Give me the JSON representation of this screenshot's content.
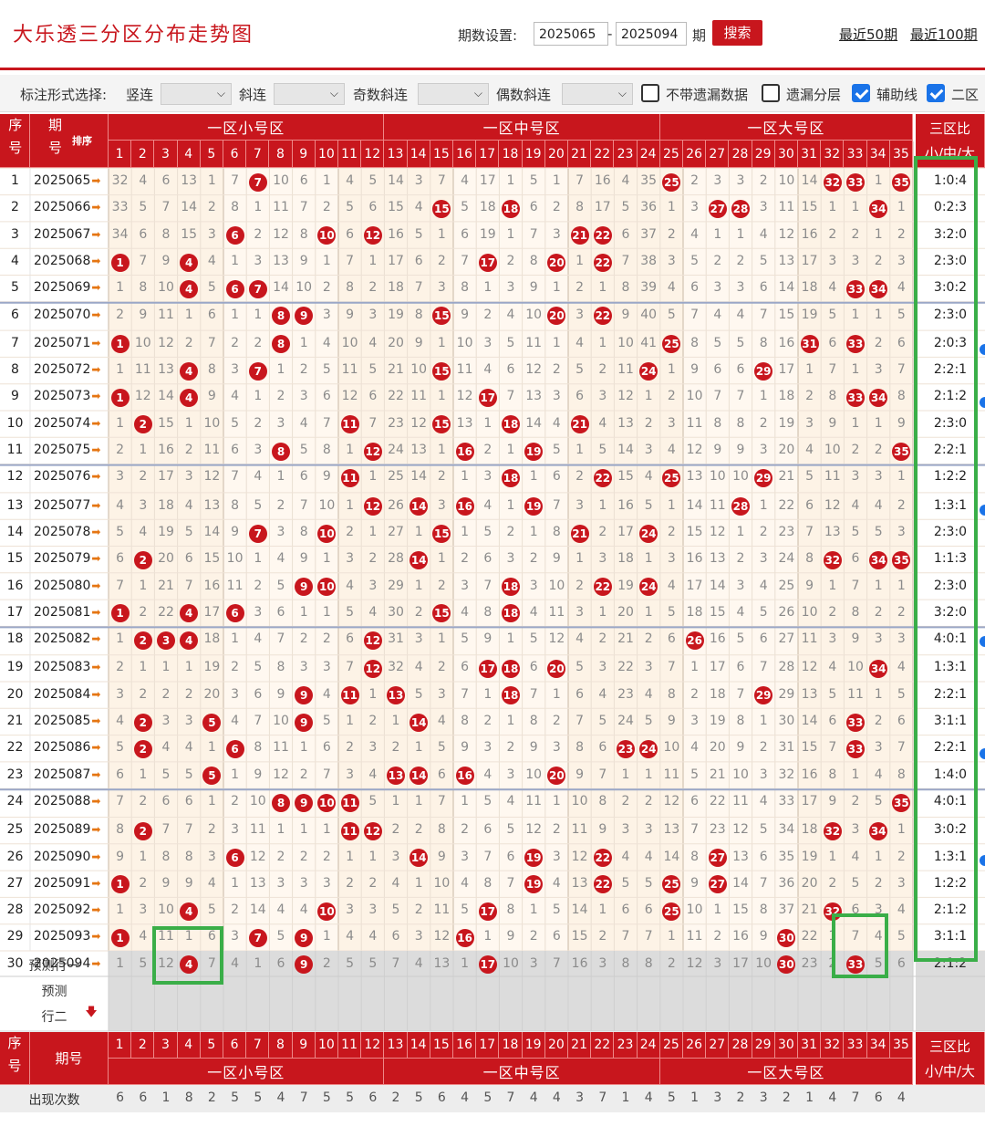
{
  "title": "大乐透三分区分布走势图",
  "search": {
    "period_label": "期数设置:",
    "from": "2025065",
    "to": "2025094",
    "sep": "-",
    "unit": "期",
    "button": "搜索",
    "link50": "最近50期",
    "link100": "最近100期"
  },
  "options": {
    "mode_label": "标注形式选择:",
    "sel1_label": "竖连",
    "sel2_label": "斜连",
    "sel3_label": "奇数斜连",
    "sel4_label": "偶数斜连",
    "cb1_label": "不带遗漏数据",
    "cb1_checked": false,
    "cb2_label": "遗漏分层",
    "cb2_checked": false,
    "cb3_label": "辅助线",
    "cb3_checked": true,
    "cb4_label": "二区",
    "cb4_checked": true
  },
  "header": {
    "seq_label": "序号",
    "issue_label": "期号",
    "sort_label": "排序",
    "zone_small": "一区小号区",
    "zone_mid": "一区中号区",
    "zone_big": "一区大号区",
    "ratio_label": "三区比",
    "ratio_sub": "小/中/大",
    "numbers": [
      "1",
      "2",
      "3",
      "4",
      "5",
      "6",
      "7",
      "8",
      "9",
      "10",
      "11",
      "12",
      "13",
      "14",
      "15",
      "16",
      "17",
      "18",
      "19",
      "20",
      "21",
      "22",
      "23",
      "24",
      "25",
      "26",
      "27",
      "28",
      "29",
      "30",
      "31",
      "32",
      "33",
      "34",
      "35"
    ]
  },
  "rows": [
    {
      "idx": "1",
      "issue": "2025065",
      "ratio": "1:0:4",
      "cells": [
        32,
        4,
        6,
        13,
        1,
        7,
        "7",
        10,
        6,
        1,
        4,
        5,
        14,
        3,
        7,
        4,
        17,
        1,
        5,
        1,
        7,
        16,
        4,
        35,
        "25",
        2,
        3,
        3,
        2,
        10,
        14,
        "32",
        "33",
        1,
        "35"
      ]
    },
    {
      "idx": "2",
      "issue": "2025066",
      "ratio": "0:2:3",
      "cells": [
        33,
        5,
        7,
        14,
        2,
        8,
        1,
        11,
        7,
        2,
        5,
        6,
        15,
        4,
        "15",
        5,
        18,
        "18",
        6,
        2,
        8,
        17,
        5,
        36,
        1,
        3,
        "27",
        "28",
        3,
        11,
        15,
        1,
        1,
        "34",
        1
      ]
    },
    {
      "idx": "3",
      "issue": "2025067",
      "ratio": "3:2:0",
      "cells": [
        34,
        6,
        8,
        15,
        3,
        "6",
        2,
        12,
        8,
        "10",
        6,
        "12",
        16,
        5,
        1,
        6,
        19,
        1,
        7,
        3,
        "21",
        "22",
        6,
        37,
        2,
        4,
        1,
        1,
        4,
        12,
        16,
        2,
        2,
        1,
        2
      ]
    },
    {
      "idx": "4",
      "issue": "2025068",
      "ratio": "2:3:0",
      "cells": [
        "1",
        7,
        9,
        "4",
        4,
        1,
        3,
        13,
        9,
        1,
        7,
        1,
        17,
        6,
        2,
        7,
        "17",
        2,
        8,
        "20",
        1,
        "22",
        7,
        38,
        3,
        5,
        2,
        2,
        5,
        13,
        17,
        3,
        3,
        2,
        3
      ]
    },
    {
      "idx": "5",
      "issue": "2025069",
      "ratio": "3:0:2",
      "cells": [
        1,
        8,
        10,
        "4",
        5,
        "6",
        "7",
        14,
        10,
        2,
        8,
        2,
        18,
        7,
        3,
        8,
        1,
        3,
        9,
        1,
        2,
        1,
        8,
        39,
        4,
        6,
        3,
        3,
        6,
        14,
        18,
        4,
        "33",
        "34",
        4
      ]
    },
    {
      "idx": "6",
      "issue": "2025070",
      "ratio": "2:3:0",
      "cells": [
        2,
        9,
        11,
        1,
        6,
        1,
        1,
        "8",
        "9",
        3,
        9,
        3,
        19,
        8,
        "15",
        9,
        2,
        4,
        10,
        "20",
        3,
        "22",
        9,
        40,
        5,
        7,
        4,
        4,
        7,
        15,
        19,
        5,
        1,
        1,
        5
      ]
    },
    {
      "idx": "7",
      "issue": "2025071",
      "ratio": "2:0:3",
      "cells": [
        "1",
        10,
        12,
        2,
        7,
        2,
        2,
        "8",
        1,
        4,
        10,
        4,
        20,
        9,
        1,
        10,
        3,
        5,
        11,
        1,
        4,
        1,
        10,
        41,
        "25",
        8,
        5,
        5,
        8,
        16,
        "31",
        6,
        "33",
        2,
        6
      ]
    },
    {
      "idx": "8",
      "issue": "2025072",
      "ratio": "2:2:1",
      "cells": [
        1,
        11,
        13,
        "4",
        8,
        3,
        "7",
        1,
        2,
        5,
        11,
        5,
        21,
        10,
        "15",
        11,
        4,
        6,
        12,
        2,
        5,
        2,
        11,
        "24",
        1,
        9,
        6,
        6,
        "29",
        17,
        1,
        7,
        1,
        3,
        7
      ]
    },
    {
      "idx": "9",
      "issue": "2025073",
      "ratio": "2:1:2",
      "cells": [
        "1",
        12,
        14,
        "4",
        9,
        4,
        1,
        2,
        3,
        6,
        12,
        6,
        22,
        11,
        1,
        12,
        "17",
        7,
        13,
        3,
        6,
        3,
        12,
        1,
        2,
        10,
        7,
        7,
        1,
        18,
        2,
        8,
        "33",
        "34",
        8
      ]
    },
    {
      "idx": "10",
      "issue": "2025074",
      "ratio": "2:3:0",
      "cells": [
        1,
        "2",
        15,
        1,
        10,
        5,
        2,
        3,
        4,
        7,
        "11",
        7,
        23,
        12,
        "15",
        13,
        1,
        "18",
        14,
        4,
        "21",
        4,
        13,
        2,
        3,
        11,
        8,
        8,
        2,
        19,
        3,
        9,
        1,
        1,
        9
      ]
    },
    {
      "idx": "11",
      "issue": "2025075",
      "ratio": "2:2:1",
      "cells": [
        2,
        1,
        16,
        2,
        11,
        6,
        3,
        "8",
        5,
        8,
        1,
        "12",
        24,
        13,
        1,
        "16",
        2,
        1,
        "19",
        5,
        1,
        5,
        14,
        3,
        4,
        12,
        9,
        9,
        3,
        20,
        4,
        10,
        2,
        2,
        "35"
      ]
    },
    {
      "idx": "12",
      "issue": "2025076",
      "ratio": "1:2:2",
      "cells": [
        3,
        2,
        17,
        3,
        12,
        7,
        4,
        1,
        6,
        9,
        "11",
        1,
        25,
        14,
        2,
        1,
        3,
        "18",
        1,
        6,
        2,
        "22",
        15,
        4,
        "25",
        13,
        10,
        10,
        "29",
        21,
        5,
        11,
        3,
        3,
        1
      ]
    },
    {
      "idx": "13",
      "issue": "2025077",
      "ratio": "1:3:1",
      "cells": [
        4,
        3,
        18,
        4,
        13,
        8,
        5,
        2,
        7,
        10,
        1,
        "12",
        26,
        "14",
        3,
        "16",
        4,
        1,
        "19",
        7,
        3,
        1,
        16,
        5,
        1,
        14,
        11,
        "28",
        1,
        22,
        6,
        12,
        4,
        4,
        2
      ]
    },
    {
      "idx": "14",
      "issue": "2025078",
      "ratio": "2:3:0",
      "cells": [
        5,
        4,
        19,
        5,
        14,
        9,
        "7",
        3,
        8,
        "10",
        2,
        1,
        27,
        1,
        "15",
        1,
        5,
        2,
        1,
        8,
        "21",
        2,
        17,
        "24",
        2,
        15,
        12,
        1,
        2,
        23,
        7,
        13,
        5,
        5,
        3
      ]
    },
    {
      "idx": "15",
      "issue": "2025079",
      "ratio": "1:1:3",
      "cells": [
        6,
        "2",
        20,
        6,
        15,
        10,
        1,
        4,
        9,
        1,
        3,
        2,
        28,
        "14",
        1,
        2,
        6,
        3,
        2,
        9,
        1,
        3,
        18,
        1,
        3,
        16,
        13,
        2,
        3,
        24,
        8,
        "32",
        6,
        "34",
        "35"
      ]
    },
    {
      "idx": "16",
      "issue": "2025080",
      "ratio": "2:3:0",
      "cells": [
        7,
        1,
        21,
        7,
        16,
        11,
        2,
        5,
        "9",
        "10",
        4,
        3,
        29,
        1,
        2,
        3,
        7,
        "18",
        3,
        10,
        2,
        "22",
        19,
        "24",
        4,
        17,
        14,
        3,
        4,
        25,
        9,
        1,
        7,
        1,
        1
      ]
    },
    {
      "idx": "17",
      "issue": "2025081",
      "ratio": "3:2:0",
      "cells": [
        "1",
        2,
        22,
        "4",
        17,
        "6",
        3,
        6,
        1,
        1,
        5,
        4,
        30,
        2,
        "15",
        4,
        8,
        "18",
        4,
        11,
        3,
        1,
        20,
        1,
        5,
        18,
        15,
        4,
        5,
        26,
        10,
        2,
        8,
        2,
        2
      ]
    },
    {
      "idx": "18",
      "issue": "2025082",
      "ratio": "4:0:1",
      "cells": [
        1,
        "2",
        "3",
        "4",
        18,
        1,
        4,
        7,
        2,
        2,
        6,
        "12",
        31,
        3,
        1,
        5,
        9,
        1,
        5,
        12,
        4,
        2,
        21,
        2,
        6,
        "26",
        16,
        5,
        6,
        27,
        11,
        3,
        9,
        3,
        3
      ]
    },
    {
      "idx": "19",
      "issue": "2025083",
      "ratio": "1:3:1",
      "cells": [
        2,
        1,
        1,
        1,
        19,
        2,
        5,
        8,
        3,
        3,
        7,
        "12",
        32,
        4,
        2,
        6,
        "17",
        "18",
        6,
        "20",
        5,
        3,
        22,
        3,
        7,
        1,
        17,
        6,
        7,
        28,
        12,
        4,
        10,
        "34",
        4
      ]
    },
    {
      "idx": "20",
      "issue": "2025084",
      "ratio": "2:2:1",
      "cells": [
        3,
        2,
        2,
        2,
        20,
        3,
        6,
        9,
        "9",
        4,
        "11",
        1,
        "13",
        5,
        3,
        7,
        1,
        "18",
        7,
        1,
        6,
        4,
        23,
        4,
        8,
        2,
        18,
        7,
        "29",
        29,
        13,
        5,
        11,
        1,
        5
      ]
    },
    {
      "idx": "21",
      "issue": "2025085",
      "ratio": "3:1:1",
      "cells": [
        4,
        "2",
        3,
        3,
        "5",
        4,
        7,
        10,
        "9",
        5,
        1,
        2,
        1,
        "14",
        4,
        8,
        2,
        1,
        8,
        2,
        7,
        5,
        24,
        5,
        9,
        3,
        19,
        8,
        1,
        30,
        14,
        6,
        "33",
        2,
        6
      ]
    },
    {
      "idx": "22",
      "issue": "2025086",
      "ratio": "2:2:1",
      "cells": [
        5,
        "2",
        4,
        4,
        1,
        "6",
        8,
        11,
        1,
        6,
        2,
        3,
        2,
        1,
        5,
        9,
        3,
        2,
        9,
        3,
        8,
        6,
        "23",
        "24",
        10,
        4,
        20,
        9,
        2,
        31,
        15,
        7,
        "33",
        3,
        7
      ]
    },
    {
      "idx": "23",
      "issue": "2025087",
      "ratio": "1:4:0",
      "cells": [
        6,
        1,
        5,
        5,
        "5",
        1,
        9,
        12,
        2,
        7,
        3,
        4,
        "13",
        "14",
        6,
        "16",
        4,
        3,
        10,
        "20",
        9,
        7,
        1,
        1,
        11,
        5,
        21,
        10,
        3,
        32,
        16,
        8,
        1,
        4,
        8
      ]
    },
    {
      "idx": "24",
      "issue": "2025088",
      "ratio": "4:0:1",
      "cells": [
        7,
        2,
        6,
        6,
        1,
        2,
        10,
        "8",
        "9",
        "10",
        "11",
        5,
        1,
        1,
        7,
        1,
        5,
        4,
        11,
        1,
        10,
        8,
        2,
        2,
        12,
        6,
        22,
        11,
        4,
        33,
        17,
        9,
        2,
        5,
        "35"
      ]
    },
    {
      "idx": "25",
      "issue": "2025089",
      "ratio": "3:0:2",
      "cells": [
        8,
        "2",
        7,
        7,
        2,
        3,
        11,
        1,
        1,
        1,
        "11",
        "12",
        2,
        2,
        8,
        2,
        6,
        5,
        12,
        2,
        11,
        9,
        3,
        3,
        13,
        7,
        23,
        12,
        5,
        34,
        18,
        "32",
        3,
        "34",
        1
      ]
    },
    {
      "idx": "26",
      "issue": "2025090",
      "ratio": "1:3:1",
      "cells": [
        9,
        1,
        8,
        8,
        3,
        "6",
        12,
        2,
        2,
        2,
        1,
        1,
        3,
        "14",
        9,
        3,
        7,
        6,
        "19",
        3,
        12,
        "22",
        4,
        4,
        14,
        8,
        "27",
        13,
        6,
        35,
        19,
        1,
        4,
        1,
        2
      ]
    },
    {
      "idx": "27",
      "issue": "2025091",
      "ratio": "1:2:2",
      "cells": [
        "1",
        2,
        9,
        9,
        4,
        1,
        13,
        3,
        3,
        3,
        2,
        2,
        4,
        1,
        10,
        4,
        8,
        7,
        "19",
        4,
        13,
        "22",
        5,
        5,
        "25",
        9,
        "27",
        14,
        7,
        36,
        20,
        2,
        5,
        2,
        3
      ]
    },
    {
      "idx": "28",
      "issue": "2025092",
      "ratio": "2:1:2",
      "cells": [
        1,
        3,
        10,
        "4",
        5,
        2,
        14,
        4,
        4,
        "10",
        3,
        3,
        5,
        2,
        11,
        5,
        "17",
        8,
        1,
        5,
        14,
        1,
        6,
        6,
        "25",
        10,
        1,
        15,
        8,
        37,
        21,
        "32",
        6,
        3,
        4
      ]
    },
    {
      "idx": "29",
      "issue": "2025093",
      "ratio": "3:1:1",
      "cells": [
        "1",
        4,
        11,
        1,
        6,
        3,
        "7",
        5,
        "9",
        1,
        4,
        4,
        6,
        3,
        12,
        "16",
        1,
        9,
        2,
        6,
        15,
        2,
        7,
        7,
        1,
        11,
        2,
        16,
        9,
        "30",
        22,
        1,
        7,
        4,
        5
      ]
    },
    {
      "idx": "30",
      "issue": "2025094",
      "ratio": "2:1:2",
      "cells": [
        1,
        5,
        12,
        "4",
        7,
        4,
        1,
        6,
        "9",
        2,
        5,
        5,
        7,
        4,
        13,
        1,
        "17",
        10,
        3,
        7,
        16,
        3,
        8,
        8,
        2,
        12,
        3,
        17,
        10,
        "30",
        23,
        2,
        "33",
        5,
        6
      ]
    }
  ],
  "predict": {
    "row1": "预测行一",
    "row2": "预测",
    "row2b": "行二"
  },
  "footer": {
    "seq_label": "序号",
    "issue_label": "期号",
    "zone_small": "一区小号区",
    "zone_mid": "一区中号区",
    "zone_big": "一区大号区",
    "ratio_label": "三区比",
    "ratio_sub": "小/中/大",
    "count_label": "出现次数",
    "counts": [
      "6",
      "6",
      "1",
      "8",
      "2",
      "5",
      "5",
      "4",
      "7",
      "5",
      "5",
      "6",
      "2",
      "5",
      "6",
      "4",
      "5",
      "7",
      "4",
      "4",
      "3",
      "7",
      "1",
      "4",
      "5",
      "1",
      "3",
      "2",
      "3",
      "2",
      "1",
      "4",
      "7",
      "6",
      "4"
    ]
  },
  "colors": {
    "brand_red": "#c8161d",
    "highlight_green": "#3aae48",
    "band_a": "#fdf3e6",
    "band_b": "#fff8f0"
  }
}
